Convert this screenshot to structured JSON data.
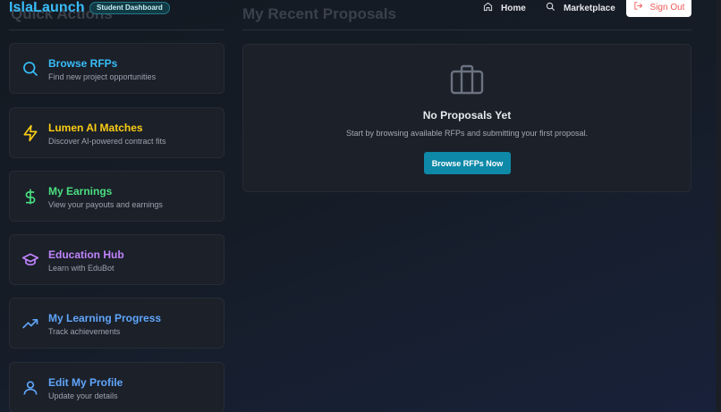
{
  "header": {
    "logo": "IslaLaunch",
    "badge": "Student Dashboard",
    "nav": {
      "home": "Home",
      "marketplace": "Marketplace"
    },
    "sign_out": "Sign Out"
  },
  "sections": {
    "quick_actions": "Quick Actions",
    "recent_proposals": "My Recent Proposals"
  },
  "quick_actions": [
    {
      "title": "Browse RFPs",
      "subtitle": "Find new project opportunities",
      "icon": "search-icon",
      "color": "#38bdf8"
    },
    {
      "title": "Lumen AI Matches",
      "subtitle": "Discover AI-powered contract fits",
      "icon": "lightning-icon",
      "color": "#facc15"
    },
    {
      "title": "My Earnings",
      "subtitle": "View your payouts and earnings",
      "icon": "dollar-icon",
      "color": "#4ade80"
    },
    {
      "title": "Education Hub",
      "subtitle": "Learn with EduBot",
      "icon": "graduation-cap-icon",
      "color": "#c084fc"
    },
    {
      "title": "My Learning Progress",
      "subtitle": "Track achievements",
      "icon": "trending-up-icon",
      "color": "#60a5fa"
    },
    {
      "title": "Edit My Profile",
      "subtitle": "Update your details",
      "icon": "user-icon",
      "color": "#60a5fa"
    }
  ],
  "proposals": {
    "empty_title": "No Proposals Yet",
    "empty_subtitle": "Start by browsing available RFPs and submitting your first proposal.",
    "cta": "Browse RFPs Now",
    "icon": "briefcase-icon"
  },
  "colors": {
    "accent": "#38bdf8",
    "button": "#0e89a8",
    "signout": "#f05a5a"
  }
}
